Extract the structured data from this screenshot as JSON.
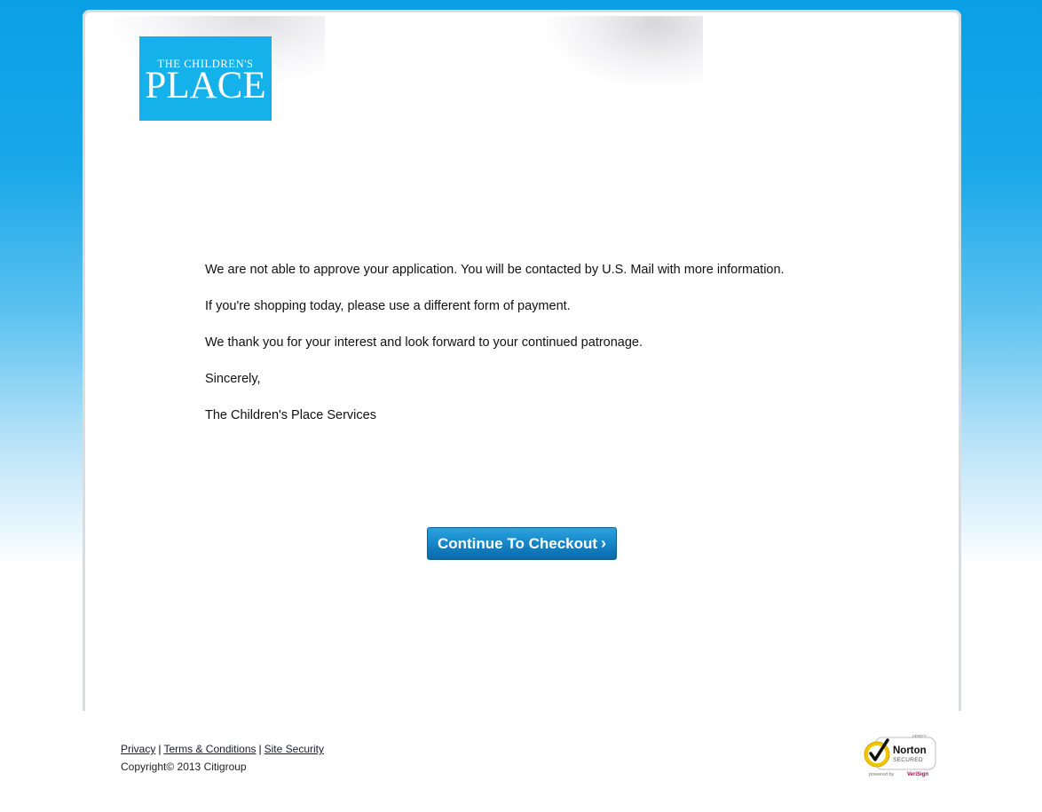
{
  "logo": {
    "line1": "THE CHILDREN'S",
    "line2": "PLACE",
    "bg_color": "#15b1ea"
  },
  "message": {
    "paragraphs": [
      "We are not able to approve your application. You will be contacted by U.S. Mail with more information.",
      "If you're shopping today, please use a different form of payment.",
      "We thank you for your interest and look forward to your continued patronage.",
      "Sincerely,",
      "The Children's Place Services"
    ]
  },
  "checkout_button": {
    "label": "Continue To Checkout",
    "chevron": "›"
  },
  "footer": {
    "links": [
      "Privacy",
      "Terms & Conditions",
      "Site Security"
    ],
    "separator": "|",
    "copyright": "Copyright© 2013 Citigroup"
  },
  "norton_badge": {
    "top_text": "VERIFY",
    "brand": "Norton",
    "status": "SECURED",
    "powered_prefix": "powered by",
    "powered_brand": "VeriSign",
    "icon": "checkmark-seal-icon"
  },
  "colors": {
    "accent_blue": "#0aa0e6",
    "button_blue": "#1786c7",
    "norton_yellow": "#f5c400"
  }
}
